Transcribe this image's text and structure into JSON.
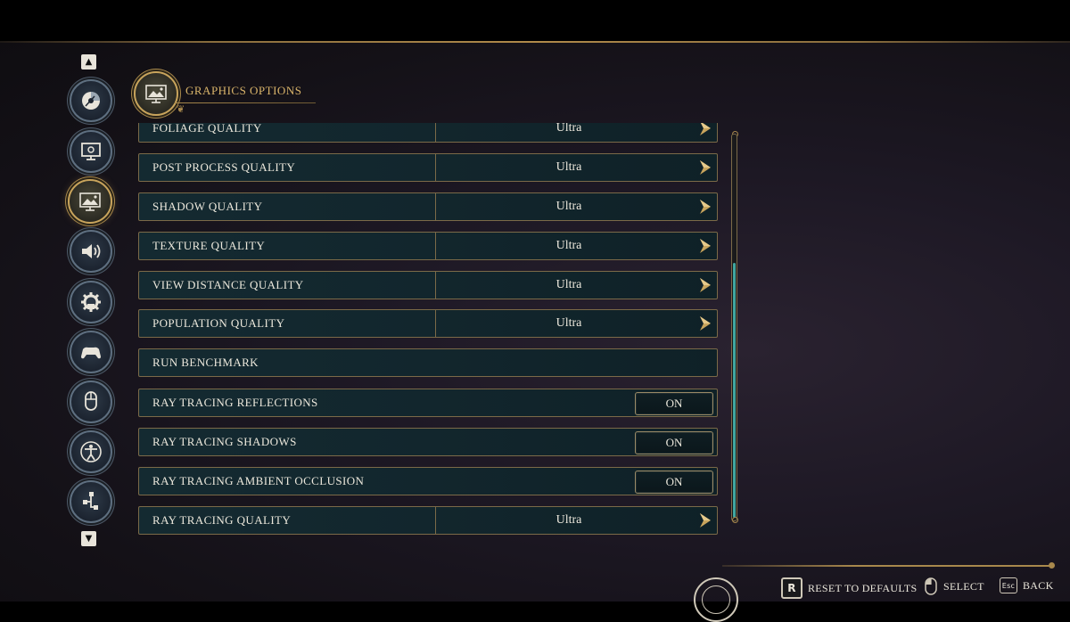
{
  "header": {
    "title": "GRAPHICS OPTIONS",
    "icon": "monitor-landscape-icon"
  },
  "sidebar": {
    "items": [
      {
        "name": "game-disc-icon",
        "active": false
      },
      {
        "name": "display-settings-icon",
        "active": false
      },
      {
        "name": "graphics-icon",
        "active": true
      },
      {
        "name": "audio-icon",
        "active": false
      },
      {
        "name": "gameplay-gear-icon",
        "active": false
      },
      {
        "name": "controller-icon",
        "active": false
      },
      {
        "name": "mouse-keyboard-icon",
        "active": false
      },
      {
        "name": "accessibility-icon",
        "active": false
      },
      {
        "name": "network-icon",
        "active": false
      }
    ]
  },
  "settings": [
    {
      "label": "FOLIAGE QUALITY",
      "type": "select",
      "value": "Ultra"
    },
    {
      "label": "POST PROCESS QUALITY",
      "type": "select",
      "value": "Ultra"
    },
    {
      "label": "SHADOW QUALITY",
      "type": "select",
      "value": "Ultra"
    },
    {
      "label": "TEXTURE QUALITY",
      "type": "select",
      "value": "Ultra"
    },
    {
      "label": "VIEW DISTANCE QUALITY",
      "type": "select",
      "value": "Ultra"
    },
    {
      "label": "POPULATION QUALITY",
      "type": "select",
      "value": "Ultra"
    },
    {
      "label": "RUN BENCHMARK",
      "type": "action"
    },
    {
      "label": "RAY TRACING REFLECTIONS",
      "type": "toggle",
      "value": "ON"
    },
    {
      "label": "RAY TRACING SHADOWS",
      "type": "toggle",
      "value": "ON"
    },
    {
      "label": "RAY TRACING AMBIENT OCCLUSION",
      "type": "toggle",
      "value": "ON"
    },
    {
      "label": "RAY TRACING QUALITY",
      "type": "select",
      "value": "Ultra"
    }
  ],
  "footer": {
    "reset": {
      "key": "R",
      "label": "RESET TO DEFAULTS"
    },
    "select": {
      "label": "SELECT",
      "icon": "mouse-icon"
    },
    "back": {
      "key": "Esc",
      "label": "BACK"
    }
  },
  "colors": {
    "gold": "#c8a45c",
    "teal_scroll": "#3fa6a0",
    "row_bg": "#142a31"
  }
}
